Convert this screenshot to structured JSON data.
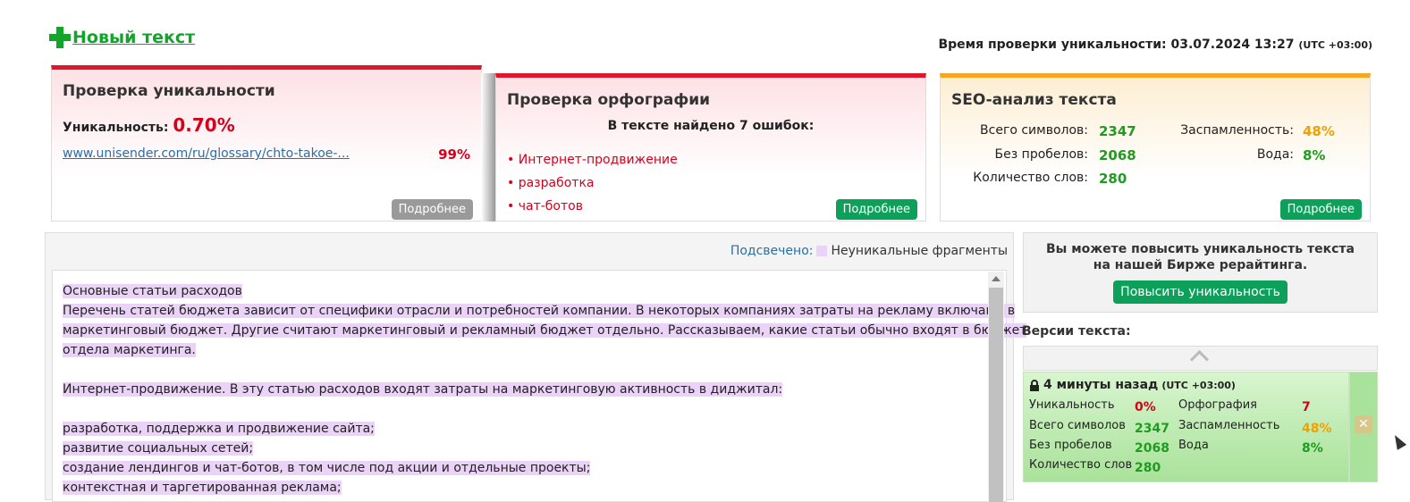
{
  "top": {
    "new_text_label": "Новый текст",
    "check_time_label": "Время проверки уникальности: 03.07.2024 13:27",
    "check_time_tz": "(UTC +03:00)"
  },
  "uniq": {
    "title": "Проверка уникальности",
    "label": "Уникальность:",
    "value": "0.70%",
    "source_link": "www.unisender.com/ru/glossary/chto-takoe-...",
    "source_pct": "99%",
    "more": "Подробнее"
  },
  "spell": {
    "title": "Проверка орфографии",
    "summary": "В тексте найдено 7 ошибок:",
    "errors": [
      "Интернет-продвижение",
      "разработка",
      "чат-ботов"
    ],
    "more": "Подробнее"
  },
  "seo": {
    "title": "SEO-анализ текста",
    "total_label": "Всего символов:",
    "total": "2347",
    "nospace_label": "Без пробелов:",
    "nospace": "2068",
    "words_label": "Количество слов:",
    "words": "280",
    "spam_label": "Заспамленность:",
    "spam": "48%",
    "water_label": "Вода:",
    "water": "8%",
    "more": "Подробнее"
  },
  "panel": {
    "highlight_label": "Подсвечено:",
    "highlight_legend": "Неуникальные фрагменты",
    "lines": [
      "Основные статьи расходов",
      "Перечень статей бюджета зависит от специфики отрасли и потребностей компании. В некоторых компаниях затраты на рекламу включают в",
      "маркетинговый бюджет. Другие считают маркетинговый и рекламный бюджет отдельно. Рассказываем, какие статьи обычно входят в бюджет",
      "отдела маркетинга.",
      "",
      "Интернет-продвижение. В эту статью расходов входят затраты на маркетинговую активность в диджитал:",
      "",
      "разработка, поддержка и продвижение сайта;",
      "развитие социальных сетей;",
      "создание лендингов и чат-ботов, в том числе под акции и отдельные проекты;",
      "контекстная и таргетированная реклама;"
    ]
  },
  "promo": {
    "text": "Вы можете повысить уникальность текста на нашей Бирже рерайтинга.",
    "button": "Повысить уникальность"
  },
  "versions": {
    "title": "Версии текста:",
    "item": {
      "time": "4 минуты назад",
      "tz": "(UTC +03:00)",
      "uniq_label": "Уникальность",
      "uniq": "0%",
      "total_label": "Всего символов",
      "total": "2347",
      "nospace_label": "Без пробелов",
      "nospace": "2068",
      "words_label": "Количество слов",
      "words": "280",
      "spell_label": "Орфография",
      "spell": "7",
      "spam_label": "Заспамленность",
      "spam": "48%",
      "water_label": "Вода",
      "water": "8%"
    }
  },
  "colors": {
    "accent_green": "#12a52a",
    "button_green": "#0da05a",
    "error_red": "#d6001c",
    "warn_orange": "#f0a000",
    "highlight": "#ead3f7"
  }
}
